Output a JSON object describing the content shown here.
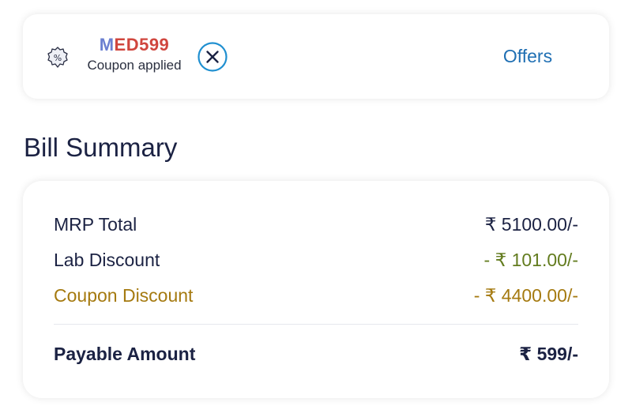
{
  "coupon": {
    "code_first_letter": "M",
    "code_rest": "ED599",
    "status": "Coupon applied",
    "badge_icon": "percent-badge-icon",
    "remove_icon": "close-circle-icon",
    "offers_label": "Offers",
    "colors": {
      "code_first": "#6b7fd0",
      "code_rest": "#d0463e",
      "remove_icon": "#1f8fd0",
      "offers": "#1f6fb3"
    }
  },
  "bill_summary": {
    "title": "Bill Summary",
    "rows": [
      {
        "label": "MRP Total",
        "value": "₹ 5100.00/-",
        "color": "#1b2243"
      },
      {
        "label": "Lab Discount",
        "value": "- ₹ 101.00/-",
        "color": "#637c1f"
      },
      {
        "label": "Coupon Discount",
        "value": "- ₹ 4400.00/-",
        "color": "#a57a10"
      }
    ],
    "payable": {
      "label": "Payable Amount",
      "value": "₹ 599/-"
    }
  }
}
